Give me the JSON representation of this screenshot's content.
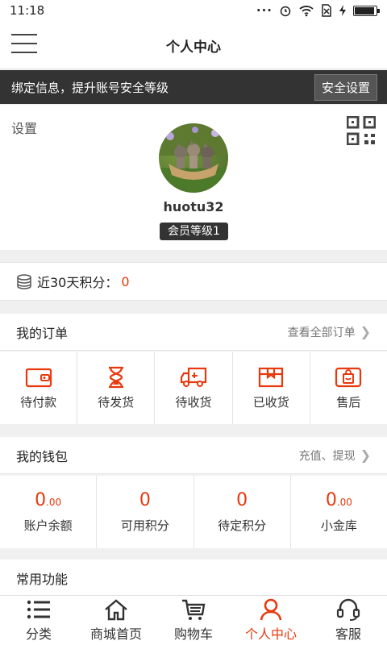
{
  "status": {
    "time": "11:18",
    "dots": "···"
  },
  "header": {
    "title": "个人中心"
  },
  "bind": {
    "text": "绑定信息，提升账号安全等级",
    "button": "安全设置"
  },
  "profile": {
    "settings": "设置",
    "username": "huotu32",
    "level": "会员等级1"
  },
  "points": {
    "label": "近30天积分：",
    "value": "0"
  },
  "orders": {
    "title": "我的订单",
    "more": "查看全部订单",
    "items": [
      {
        "label": "待付款",
        "icon": "wallet-icon"
      },
      {
        "label": "待发货",
        "icon": "hourglass-icon"
      },
      {
        "label": "待收货",
        "icon": "truck-icon"
      },
      {
        "label": "已收货",
        "icon": "box-icon"
      },
      {
        "label": "售后",
        "icon": "bag-icon"
      }
    ]
  },
  "wallet": {
    "title": "我的钱包",
    "more": "充值、提现",
    "items": [
      {
        "num": "0",
        "dec": ".00",
        "label": "账户余额"
      },
      {
        "num": "0",
        "dec": "",
        "label": "可用积分"
      },
      {
        "num": "0",
        "dec": "",
        "label": "待定积分"
      },
      {
        "num": "0",
        "dec": ".00",
        "label": "小金库"
      }
    ]
  },
  "common": {
    "title": "常用功能"
  },
  "nav": {
    "items": [
      {
        "label": "分类",
        "icon": "list-icon"
      },
      {
        "label": "商城首页",
        "icon": "home-icon"
      },
      {
        "label": "购物车",
        "icon": "cart-icon"
      },
      {
        "label": "个人中心",
        "icon": "person-icon",
        "active": true
      },
      {
        "label": "客服",
        "icon": "headset-icon"
      }
    ]
  },
  "colors": {
    "accent": "#e8380d",
    "dark": "#333333"
  }
}
